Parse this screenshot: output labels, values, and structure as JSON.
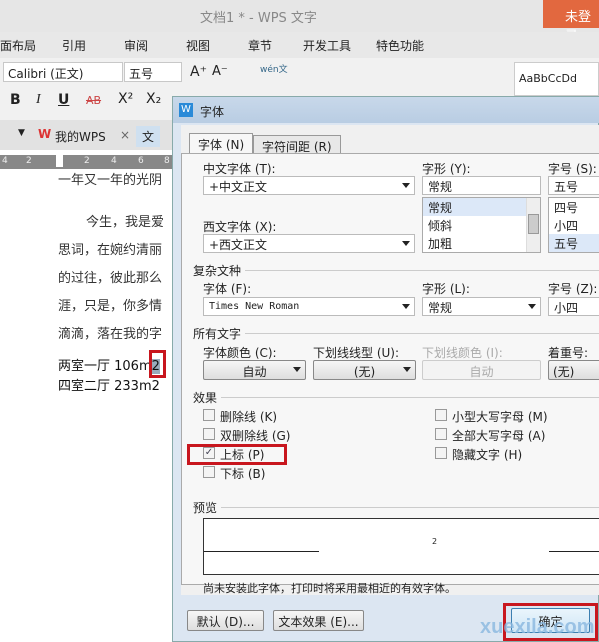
{
  "window": {
    "title": "文档1 * - WPS 文字",
    "login": "未登录"
  },
  "menu": [
    "面布局",
    "引用",
    "审阅",
    "视图",
    "章节",
    "开发工具",
    "特色功能"
  ],
  "toolbar": {
    "font": "Calibri (正文)",
    "size": "五号",
    "style_preview": "AaBbCcDd",
    "bold": "B",
    "italic": "I",
    "underline": "U",
    "strike": "AB",
    "superscript": "X²",
    "subscript": "X₂",
    "grow": "A⁺",
    "shrink": "A⁻",
    "pinyin": "wén文"
  },
  "tabs": {
    "mywps": "我的WPS",
    "doc": "文"
  },
  "ruler": [
    "4",
    "2",
    "",
    "2",
    "4",
    "6",
    "8"
  ],
  "document": {
    "lines": [
      "一年又一年的光阴",
      "今生，我是爱",
      "思词，在婉约清丽",
      "的过往，彼此那么",
      "涯，只是，你多情",
      "滴滴，落在我的字"
    ],
    "room1": "两室一厅 106m",
    "room1_sup": "2",
    "room2": "四室二厅 233m2"
  },
  "dialog": {
    "title": "字体",
    "tabs": [
      "字体 (N)",
      "字符间距 (R)"
    ],
    "chinese_font_label": "中文字体 (T):",
    "chinese_font": "+中文正文",
    "western_font_label": "西文字体 (X):",
    "western_font": "+西文正文",
    "style_label": "字形 (Y):",
    "style_value": "常规",
    "style_options": [
      "常规",
      "倾斜",
      "加粗"
    ],
    "size_label": "字号 (S):",
    "size_value": "五号",
    "size_options": [
      "四号",
      "小四",
      "五号"
    ],
    "complex": {
      "heading": "复杂文种",
      "font_label": "字体 (F):",
      "font": "Times New Roman",
      "style_label": "字形 (L):",
      "style": "常规",
      "size_label": "字号 (Z):",
      "size": "小四"
    },
    "all_text": {
      "heading": "所有文字",
      "color_label": "字体颜色 (C):",
      "color": "自动",
      "underline_label": "下划线线型 (U):",
      "underline": "(无)",
      "underline_color_label": "下划线颜色 (I):",
      "underline_color": "自动",
      "emphasis_label": "着重号:",
      "emphasis": "(无)"
    },
    "effects": {
      "heading": "效果",
      "items": [
        {
          "label": "删除线 (K)",
          "checked": false
        },
        {
          "label": "双删除线 (G)",
          "checked": false
        },
        {
          "label": "上标 (P)",
          "checked": true
        },
        {
          "label": "下标 (B)",
          "checked": false
        },
        {
          "label": "小型大写字母 (M)",
          "checked": false
        },
        {
          "label": "全部大写字母 (A)",
          "checked": false
        },
        {
          "label": "隐藏文字 (H)",
          "checked": false
        }
      ]
    },
    "preview_heading": "预览",
    "preview_text": "2",
    "note": "尚未安装此字体，打印时将采用最相近的有效字体。",
    "default_btn": "默认 (D)...",
    "text_effect_btn": "文本效果 (E)...",
    "ok_btn": "确定"
  },
  "watermark": "xuexila.com",
  "colors": {
    "highlight": "#c8161e",
    "login": "#e2683f"
  }
}
